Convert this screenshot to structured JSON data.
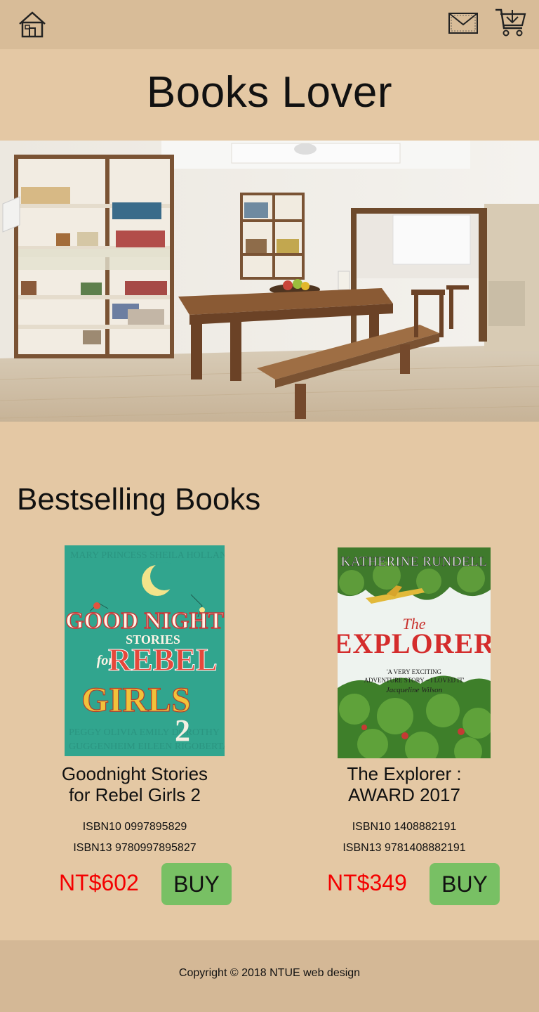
{
  "header": {
    "icons": [
      "home-icon",
      "mail-icon",
      "shopping-cart-icon"
    ]
  },
  "site": {
    "title": "Books Lover"
  },
  "hero": {
    "image": "library-room-photo"
  },
  "bestsellers": {
    "heading": "Bestselling Books",
    "books": [
      {
        "title_line1": "Goodnight Stories",
        "title_line2": "for Rebel Girls 2",
        "isbn10": "ISBN10 0997895829",
        "isbn13": "ISBN13 9780997895827",
        "price": "NT$602",
        "buy_label": "BUY"
      },
      {
        "title_line1": "The Explorer :",
        "title_line2": "AWARD 2017",
        "isbn10": "ISBN10 1408882191",
        "isbn13": "ISBN13 9781408882191",
        "price": "NT$349",
        "buy_label": "BUY",
        "cover_author": "KATHERINE RUNDELL",
        "cover_title_small": "The",
        "cover_title_big": "EXPLORER",
        "cover_quote_line1": "'A VERY EXCITING",
        "cover_quote_line2": "ADVENTURE STORY – I LOVED IT'",
        "cover_quote_author": "Jacqueline Wilson"
      }
    ]
  },
  "footer": {
    "copyright": "Copyright © 2018 NTUE web design"
  },
  "colors": {
    "background": "#e4c8a4",
    "topbar": "#d8bc98",
    "price": "#f40000",
    "buy_button": "#78c064",
    "footer": "#d4b896"
  }
}
